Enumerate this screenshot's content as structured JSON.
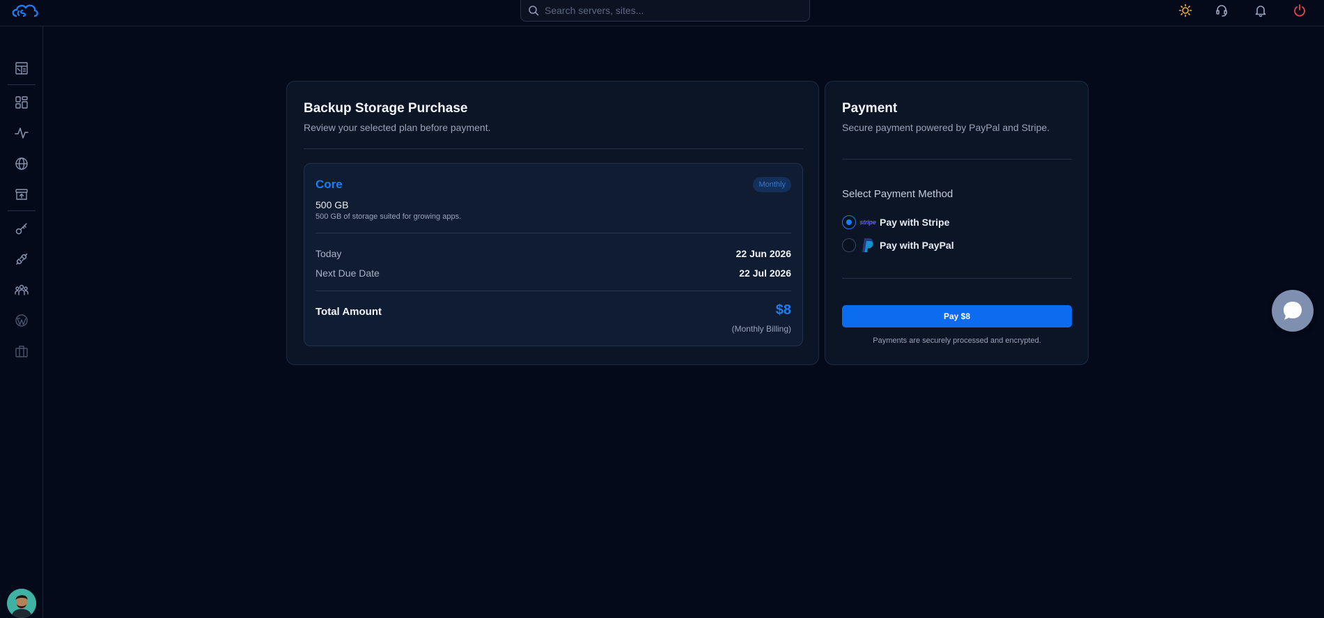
{
  "topbar": {
    "logo_alt": "cs logo",
    "search_placeholder": "Search servers, sites...",
    "icons": [
      "sun-icon",
      "headset-icon",
      "bell-icon",
      "power-icon"
    ]
  },
  "sidebar": {
    "items": [
      {
        "icon": "dashboard-layout-icon"
      },
      {
        "icon": "apps-grid-icon"
      },
      {
        "icon": "activity-icon"
      },
      {
        "icon": "globe-icon"
      },
      {
        "icon": "archive-upload-icon"
      },
      {
        "icon": "key-icon"
      },
      {
        "icon": "plug-icon"
      },
      {
        "icon": "team-icon"
      },
      {
        "icon": "wordpress-icon"
      },
      {
        "icon": "briefcase-icon"
      }
    ]
  },
  "purchase": {
    "title": "Backup Storage Purchase",
    "subtitle": "Review your selected plan before payment.",
    "plan": {
      "name": "Core",
      "badge": "Monthly",
      "size": "500 GB",
      "description": "500 GB of storage suited for growing apps."
    },
    "rows": [
      {
        "label": "Today",
        "value": "22 Jun 2026"
      },
      {
        "label": "Next Due Date",
        "value": "22 Jul 2026"
      }
    ],
    "total_label": "Total Amount",
    "total_value": "$8",
    "total_note": "(Monthly Billing)"
  },
  "payment": {
    "title": "Payment",
    "subtitle": "Secure payment powered by PayPal and Stripe.",
    "method_heading": "Select Payment Method",
    "methods": [
      {
        "label": "Pay with Stripe",
        "brand": "stripe",
        "selected": true
      },
      {
        "label": "Pay with PayPal",
        "brand": "paypal",
        "selected": false
      }
    ],
    "pay_button": "Pay $8",
    "note": "Payments are securely processed and encrypted."
  },
  "colors": {
    "background": "#040a1a",
    "card": "#0c1526",
    "accent": "#1e7cf2",
    "button": "#0b6cf0",
    "sun": "#f2b233",
    "power": "#e5484d"
  }
}
